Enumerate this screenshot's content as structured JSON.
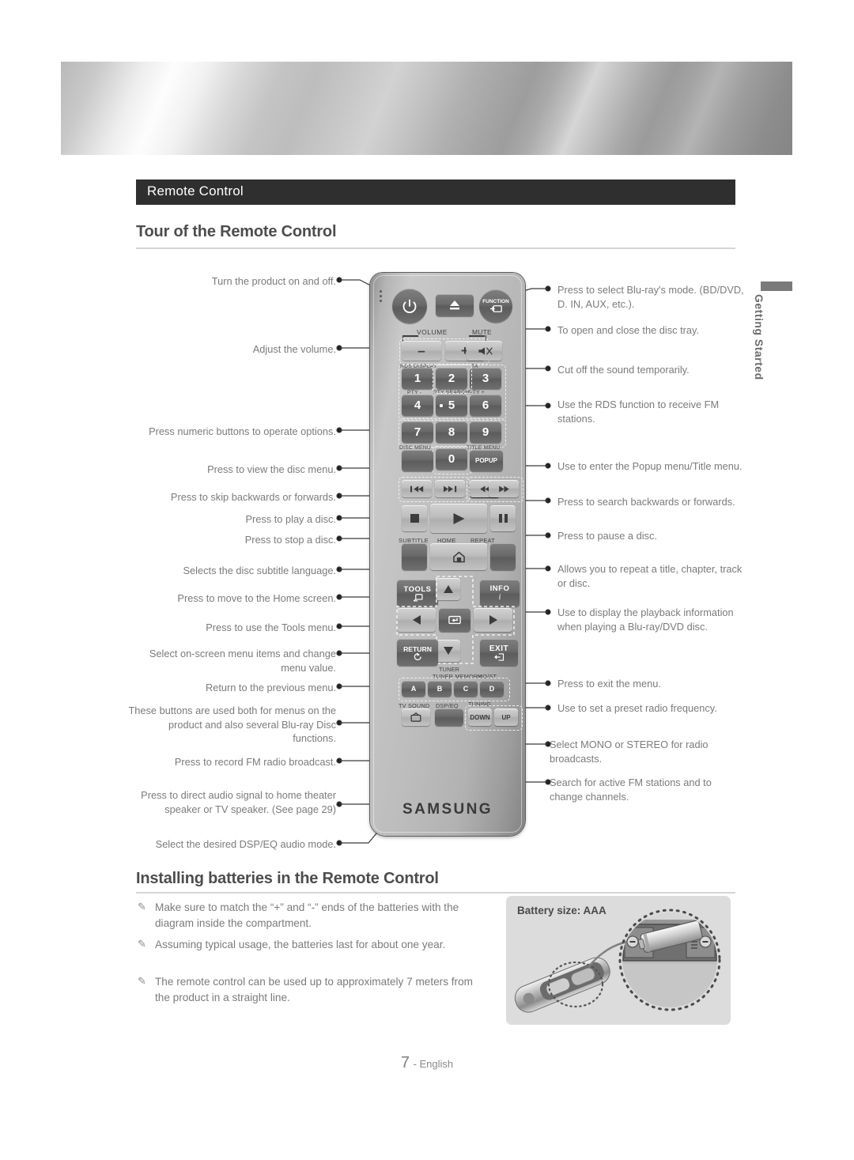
{
  "page": {
    "section_title": "Remote Control",
    "heading_tour": "Tour of the Remote Control",
    "heading_batteries": "Installing batteries in the Remote Control",
    "side_tab": "Getting Started",
    "footer_page": "7",
    "footer_lang": "- English"
  },
  "callouts_left": [
    {
      "text": "Turn the product on and off."
    },
    {
      "text": "Adjust the volume."
    },
    {
      "text": "Press numeric buttons to operate options."
    },
    {
      "text": "Press to view the disc menu."
    },
    {
      "text": "Press to skip backwards or forwards."
    },
    {
      "text": "Press to play a disc."
    },
    {
      "text": "Press to stop a disc."
    },
    {
      "text": "Selects the disc subtitle language."
    },
    {
      "text": "Press to move to the Home screen."
    },
    {
      "text": "Press to use the Tools menu."
    },
    {
      "text": "Select on-screen menu items and change menu value."
    },
    {
      "text": "Return to the previous menu."
    },
    {
      "text": "These buttons are used both for menus on the product and also several Blu-ray Disc functions."
    },
    {
      "text": "Press to record FM radio broadcast."
    },
    {
      "text": "Press to direct audio signal to home theater speaker or TV speaker. (See page 29)"
    },
    {
      "text": "Select the desired DSP/EQ audio mode."
    }
  ],
  "callouts_right": [
    {
      "text": "Press to select Blu-ray's mode. (BD/DVD, D. IN, AUX, etc.)."
    },
    {
      "text": "To open and close the disc tray."
    },
    {
      "text": "Cut off the sound temporarily."
    },
    {
      "text": "Use the RDS function to receive FM stations."
    },
    {
      "text": "Use to enter the Popup menu/Title menu."
    },
    {
      "text": "Press to search backwards or forwards."
    },
    {
      "text": "Press to pause a disc."
    },
    {
      "text": "Allows you to repeat a title, chapter, track or disc."
    },
    {
      "text": "Use to display the playback information when playing a Blu-ray/DVD disc."
    },
    {
      "text": "Press to exit the menu."
    },
    {
      "text": "Use to set a preset radio frequency."
    },
    {
      "text": "Select MONO or STEREO for radio broadcasts."
    },
    {
      "text": "Search for active FM stations and to change channels."
    }
  ],
  "remote": {
    "brand": "SAMSUNG",
    "buttons": {
      "power": "power-icon",
      "eject": "eject-icon",
      "function": "FUNCTION",
      "volume_group": "VOLUME",
      "volume_down": "–",
      "volume_up": "+",
      "mute_label": "MUTE",
      "mute": "mute-icon",
      "rds_display": "RDS DISPLAY",
      "ta": "TA",
      "pty_minus": "PTY -",
      "pty_search": "PTY SEARCH",
      "pty_plus": "PTY +",
      "num1": "1",
      "num2": "2",
      "num3": "3",
      "num4": "4",
      "num5": "5",
      "num6": "6",
      "num7": "7",
      "num8": "8",
      "num9": "9",
      "num0": "0",
      "disc_menu": "DISC MENU",
      "title_menu": "TITLE MENU",
      "popup": "POPUP",
      "skip_back": "⏮",
      "skip_fwd": "⏭",
      "search_back": "◀◀",
      "search_fwd": "▶▶",
      "stop": "■",
      "play": "▶",
      "pause": "▐▌",
      "subtitle": "SUBTITLE",
      "home_label": "HOME",
      "home": "home-icon",
      "repeat": "REPEAT",
      "tools": "TOOLS",
      "info": "INFO",
      "info_glyph": "i",
      "up": "▲",
      "down": "▼",
      "left": "◀",
      "right": "▶",
      "enter": "enter-icon",
      "return": "RETURN",
      "exit": "EXIT",
      "tuner_memory": "TUNER MEMORY",
      "mo_st": "MO/ST",
      "color_a": "A",
      "color_b": "B",
      "color_c": "C",
      "color_d": "D",
      "tv_sound": "TV SOUND",
      "dsp_eq": "DSP/EQ",
      "tuning": "TUNING",
      "tuning_down": "DOWN",
      "tuning_up": "UP"
    }
  },
  "notes": [
    "Make sure to match the “+” and “-” ends of the batteries with the diagram inside the compartment.",
    "Assuming typical usage, the batteries last for about one year.",
    "The remote control can be used up to approximately 7 meters from the product in a straight line."
  ],
  "battery_panel": {
    "label": "Battery size: AAA"
  },
  "colors": {
    "title_bar": "#2f2f2f",
    "text": "#7b7b7b",
    "heading": "#4d4d4d",
    "rule": "#d5d5d5",
    "panel_bg": "#dcdcdc"
  }
}
